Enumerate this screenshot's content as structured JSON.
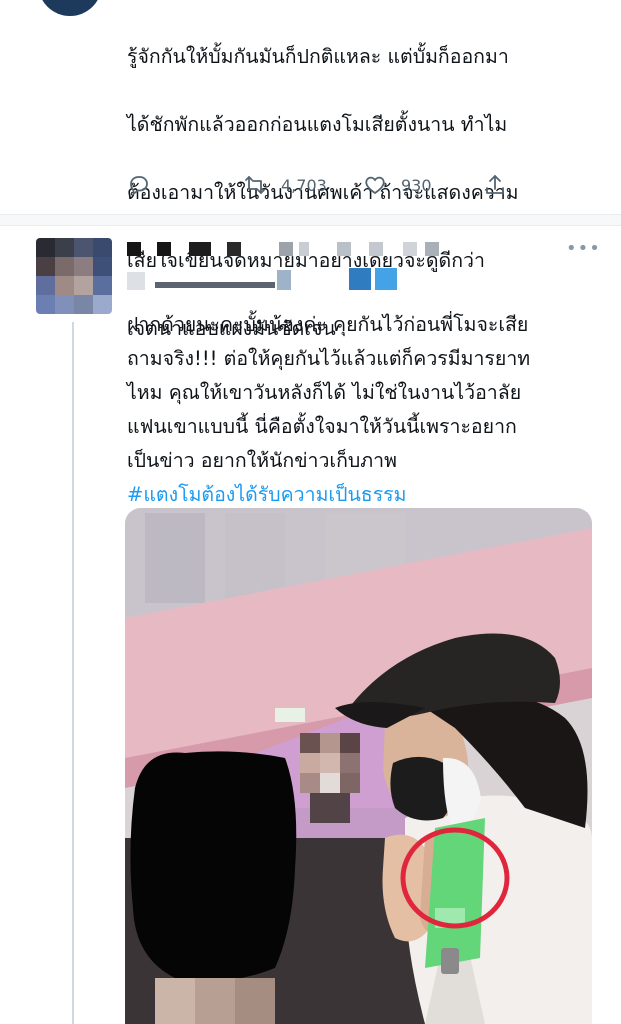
{
  "tweet1": {
    "lines": [
      "รู้จักกันให้บั้มกันมันก็ปกติแหละ แต่บั้มก็ออกมา",
      "ได้ชักพักแล้วออกก่อนแตงโมเสียตั้งนาน ทำไม",
      "ต้องเอามาให้ในวันงานศพเค้า ถ้าจะแสดงความ",
      "เสียใจเขียนจดหมายมาอย่างเดียวจะดูดีกว่า",
      "เจตนาแอบแฝงมันชัดเจน"
    ],
    "actions": {
      "reply_icon": "reply-icon",
      "retweet_icon": "retweet-icon",
      "retweet_count": "4,703",
      "like_icon": "like-icon",
      "like_count": "930",
      "share_icon": "share-icon"
    }
  },
  "tweet2": {
    "more_label": "•••",
    "lines": [
      "ฝากด้วยนะคะบั้มน้องค่ะ คุยกันไว้ก่อนพี่โมจะเสีย",
      "ถามจริง!!! ต่อให้คุยกันไว้แล้วแต่ก็ควรมีมารยาท",
      "ไหม คุณให้เขาวันหลังก็ได้ ไม่ใช่ในงานไว้อาลัย",
      "แฟนเขาแบบนี้ นี่คือตั้งใจมาให้วันนี้เพราะอยาก",
      "เป็นข่าว อยากให้นักข่าวเก็บภาพ"
    ],
    "hashtag": "#แตงโมต้องได้รับความเป็นธรรม",
    "colors": {
      "hashtag": "#1d9bf0",
      "highlight_circle": "#e0263c"
    }
  }
}
